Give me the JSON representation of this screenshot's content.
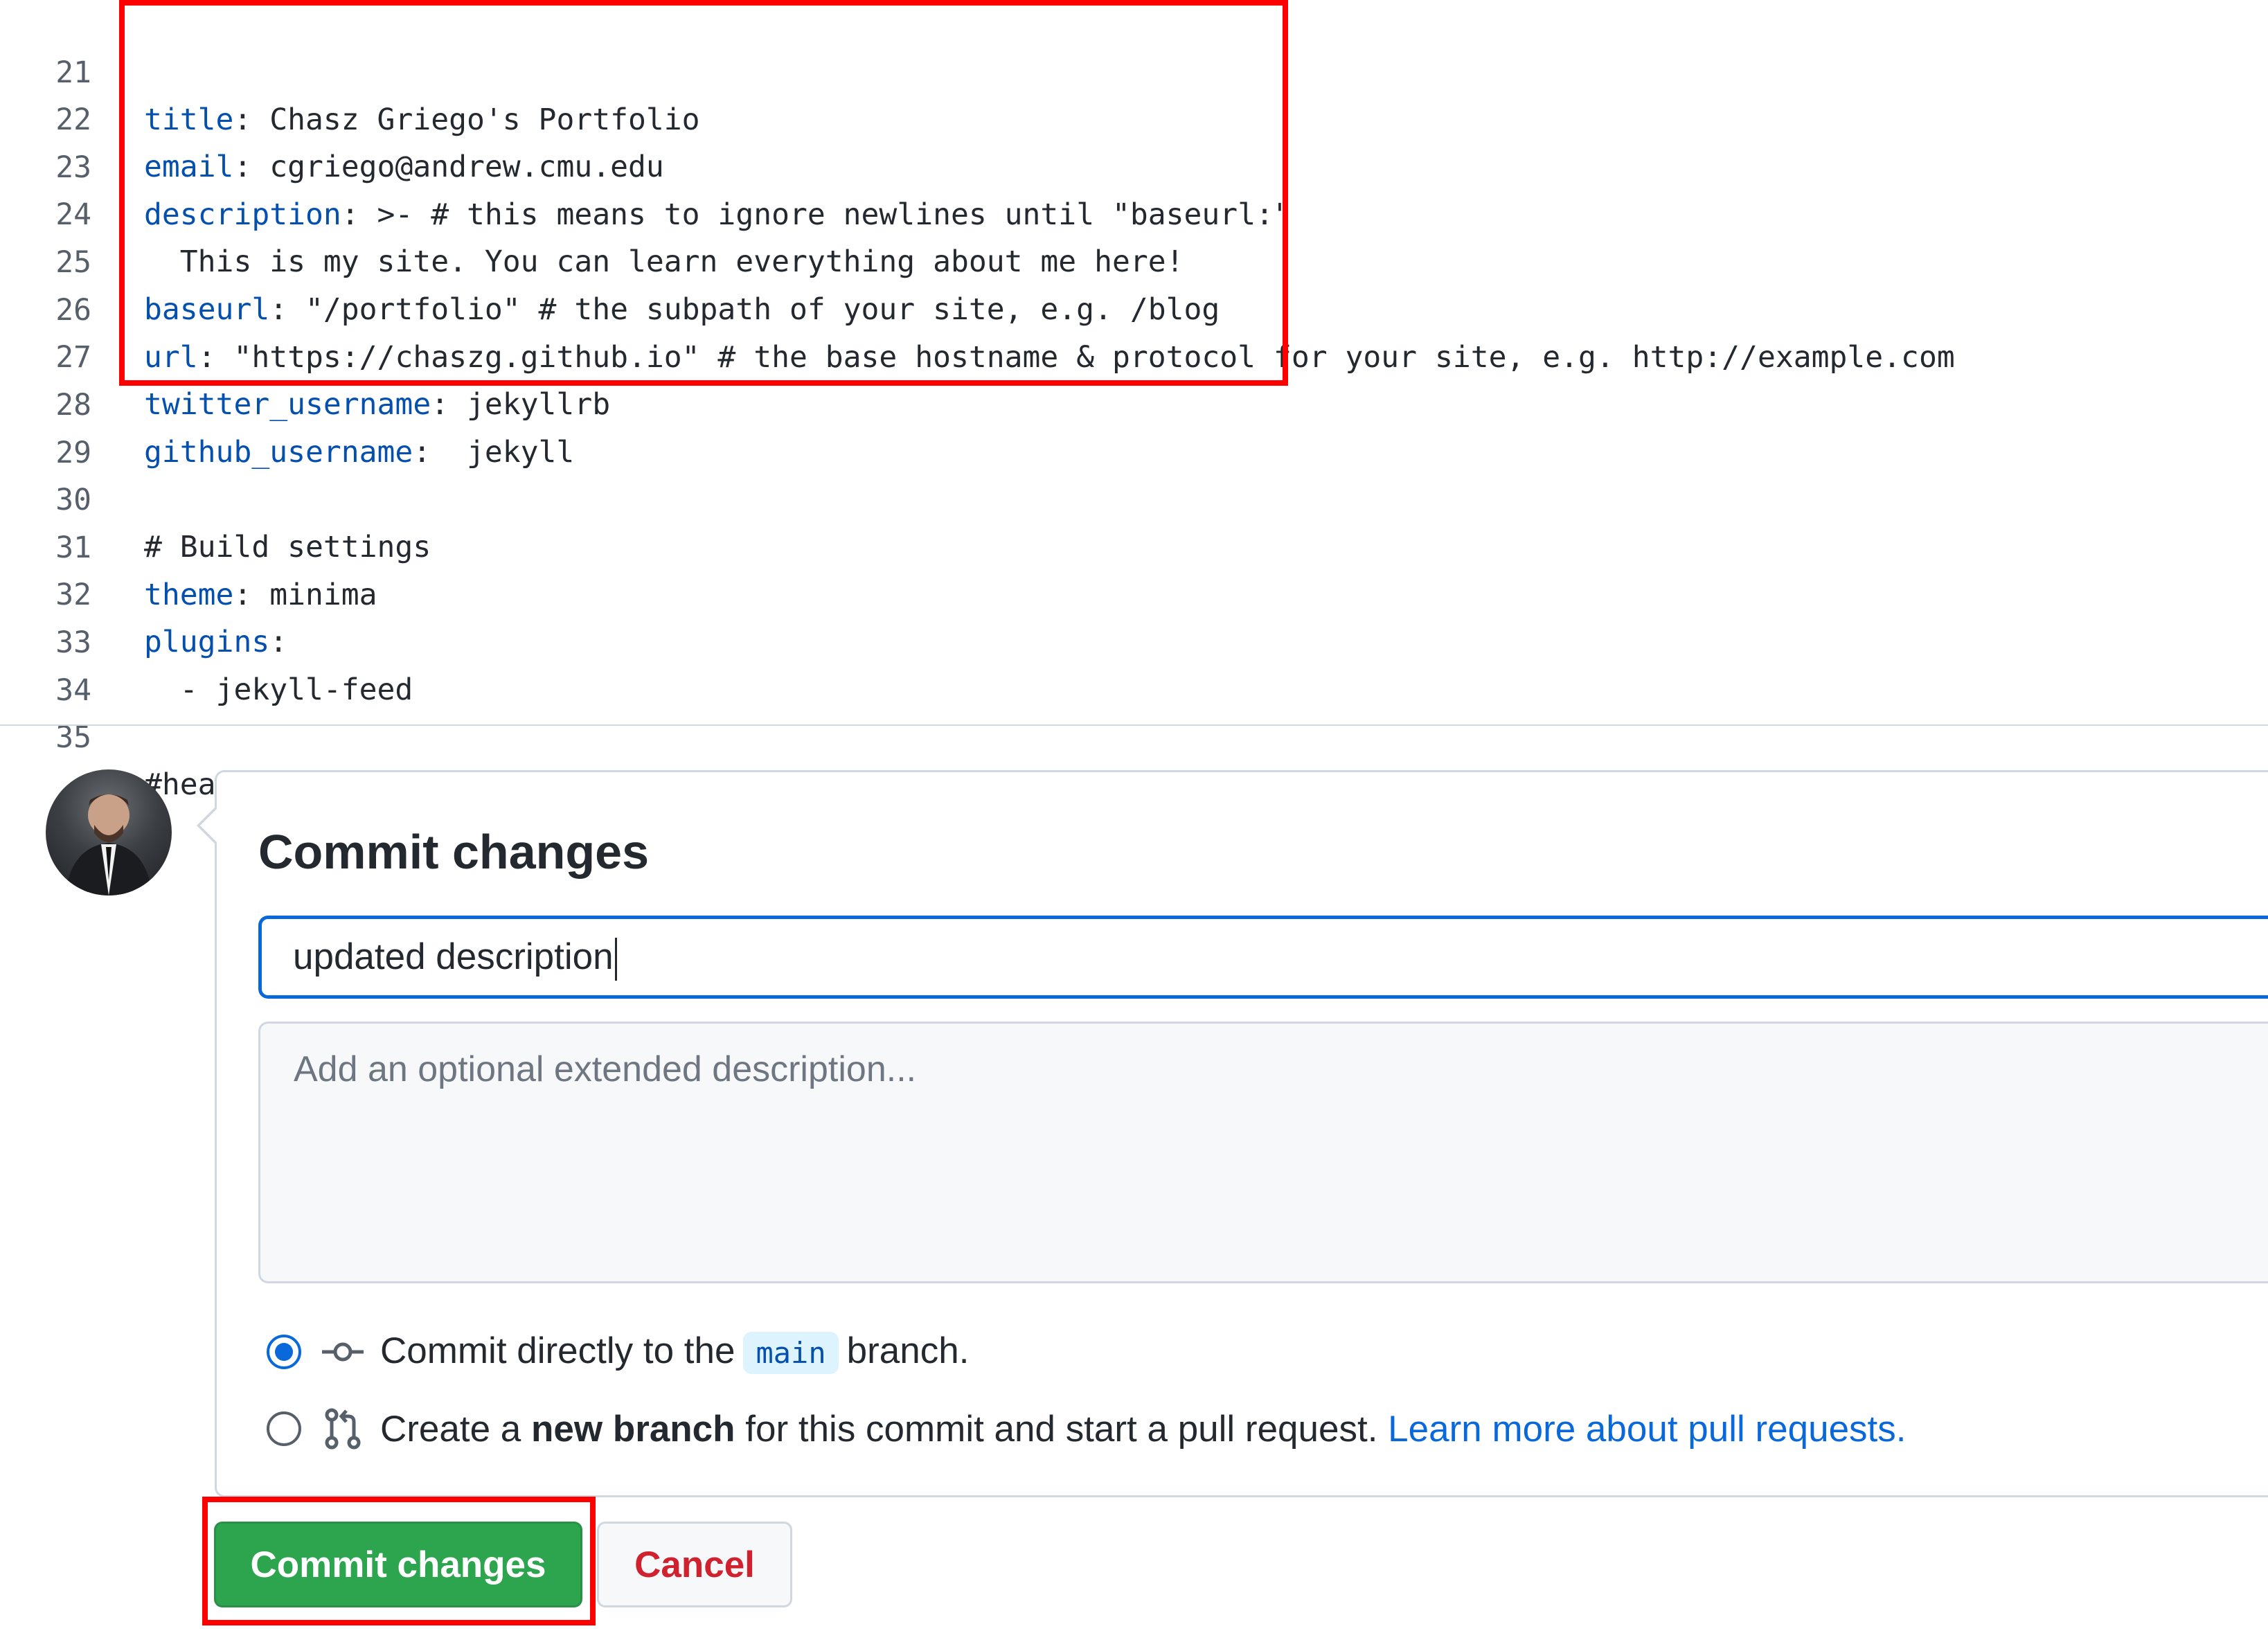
{
  "code_lines": [
    {
      "n": "21",
      "key": "title",
      "rest": ": Chasz Griego's Portfolio"
    },
    {
      "n": "22",
      "key": "email",
      "rest": ": cgriego@andrew.cmu.edu"
    },
    {
      "n": "23",
      "key": "description",
      "rest": ": >- # this means to ignore newlines until \"baseurl:\""
    },
    {
      "n": "24",
      "key": "",
      "rest": "  This is my site. You can learn everything about me here!"
    },
    {
      "n": "25",
      "key": "baseurl",
      "rest": ": \"/portfolio\" # the subpath of your site, e.g. /blog"
    },
    {
      "n": "26",
      "key": "url",
      "rest": ": \"https://chaszg.github.io\" # the base hostname & protocol for your site, e.g. http://example.com"
    },
    {
      "n": "27",
      "key": "twitter_username",
      "rest": ": jekyllrb"
    },
    {
      "n": "28",
      "key": "github_username",
      "rest": ":  jekyll"
    },
    {
      "n": "29",
      "key": "",
      "rest": ""
    },
    {
      "n": "30",
      "key": "",
      "rest": "# Build settings"
    },
    {
      "n": "31",
      "key": "theme",
      "rest": ": minima"
    },
    {
      "n": "32",
      "key": "plugins",
      "rest": ":"
    },
    {
      "n": "33",
      "key": "",
      "rest": "  - jekyll-feed"
    },
    {
      "n": "34",
      "key": "",
      "rest": ""
    },
    {
      "n": "35",
      "key": "",
      "rest": "#header_pages:"
    }
  ],
  "commit": {
    "title": "Commit changes",
    "summary_value": "updated description",
    "description_placeholder": "Add an optional extended description...",
    "option_direct": {
      "prefix": "Commit directly to the",
      "branch": "main",
      "suffix": "branch."
    },
    "option_new_branch": {
      "prefix": "Create a",
      "bold": "new branch",
      "suffix": "for this commit and start a pull request.",
      "link": "Learn more about pull requests."
    },
    "commit_button": "Commit changes",
    "cancel_button": "Cancel"
  },
  "icons": {
    "avatar": "user-avatar",
    "commit": "git-commit-icon",
    "pull_request": "git-pull-request-icon"
  },
  "colors": {
    "key": "#0550ae",
    "link": "#0969da",
    "commit_button": "#2da44e",
    "cancel_text": "#cf222e",
    "highlight": "#ff0000"
  }
}
